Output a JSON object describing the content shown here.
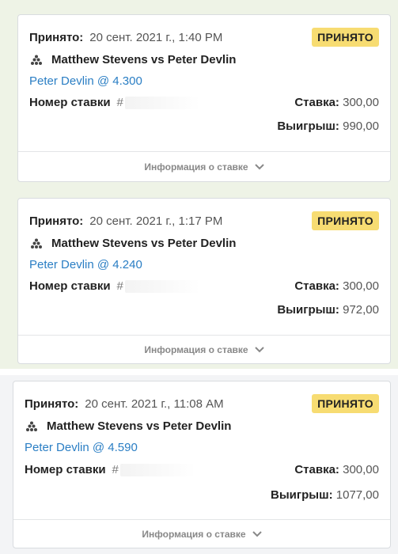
{
  "bets": [
    {
      "accepted_label": "Принято:",
      "date": "20 сент. 2021 г., 1:40 PM",
      "status": "ПРИНЯТО",
      "match": "Matthew Stevens vs Peter Devlin",
      "selection": "Peter Devlin @ 4.300",
      "bet_number_label": "Номер ставки",
      "bet_number_prefix": "#",
      "stake_label": "Ставка:",
      "stake": "300,00",
      "win_label": "Выигрыш:",
      "win": "990,00",
      "details": "Информация о ставке"
    },
    {
      "accepted_label": "Принято:",
      "date": "20 сент. 2021 г., 1:17 PM",
      "status": "ПРИНЯТО",
      "match": "Matthew Stevens vs Peter Devlin",
      "selection": "Peter Devlin @ 4.240",
      "bet_number_label": "Номер ставки",
      "bet_number_prefix": "#",
      "stake_label": "Ставка:",
      "stake": "300,00",
      "win_label": "Выигрыш:",
      "win": "972,00",
      "details": "Информация о ставке"
    },
    {
      "accepted_label": "Принято:",
      "date": "20 сент. 2021 г., 11:08 AM",
      "status": "ПРИНЯТО",
      "match": "Matthew Stevens vs Peter Devlin",
      "selection": "Peter Devlin @ 4.590",
      "bet_number_label": "Номер ставки",
      "bet_number_prefix": "#",
      "stake_label": "Ставка:",
      "stake": "300,00",
      "win_label": "Выигрыш:",
      "win": "1077,00",
      "details": "Информация о ставке"
    }
  ],
  "colors": {
    "badge": "#f7dc72",
    "link": "#2a7ec4",
    "background": "#eef3e6"
  },
  "icons": {
    "sport": "snooker-triangle-icon",
    "expand": "chevron-down-icon"
  }
}
